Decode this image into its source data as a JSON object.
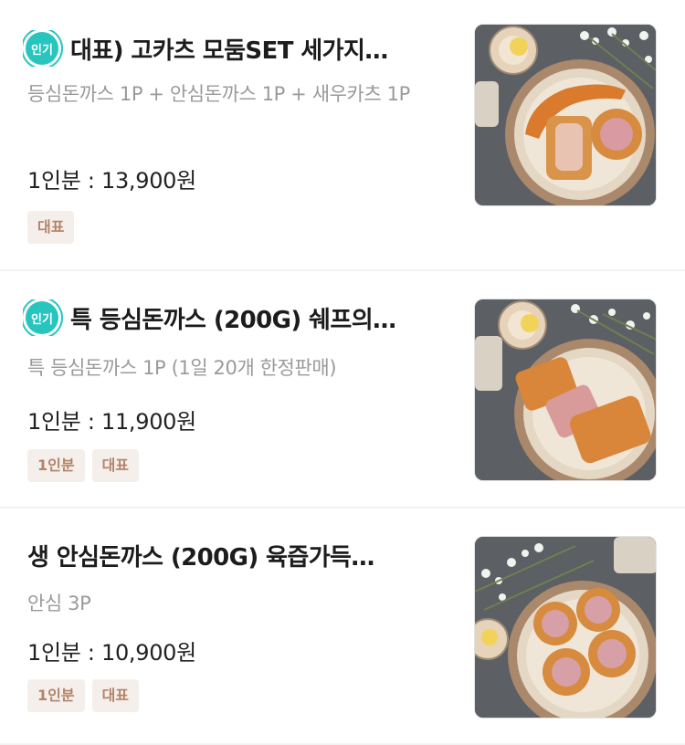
{
  "menu_items": [
    {
      "popular_badge": "인기",
      "title": "대표) 고카츠 모둠SET 세가지…",
      "description": "등심돈까스 1P + 안심돈까스 1P + 새우카츠 1P",
      "price": "1인분 : 13,900원",
      "tags": [
        "대표"
      ],
      "image_icon": "food-photo-mixed-katsu-set"
    },
    {
      "popular_badge": "인기",
      "title": "특 등심돈까스 (200G) 쉐프의…",
      "description": "특 등심돈까스 1P (1일 20개 한정판매)",
      "price": "1인분 : 11,900원",
      "tags": [
        "1인분",
        "대표"
      ],
      "image_icon": "food-photo-pork-loin-katsu"
    },
    {
      "title": "생 안심돈까스 (200G) 육즙가득…",
      "description": "안심 3P",
      "price": "1인분 : 10,900원",
      "tags": [
        "1인분",
        "대표"
      ],
      "image_icon": "food-photo-tenderloin-katsu"
    }
  ],
  "colors": {
    "badge": "#28c5bf",
    "tag_bg": "#f4efea",
    "tag_text": "#b3836a"
  }
}
